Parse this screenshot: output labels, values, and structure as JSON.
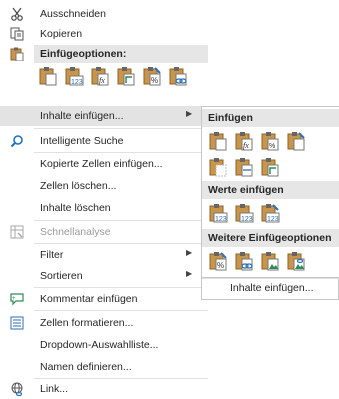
{
  "context_menu": {
    "items": [
      {
        "label": "Ausschneiden",
        "icon": "scissors-icon"
      },
      {
        "label": "Kopieren",
        "icon": "copy-icon"
      },
      {
        "label": "Einfügeoptionen:",
        "icon": "paste-icon"
      },
      {
        "label": "Inhalte einfügen...",
        "icon": "none"
      },
      {
        "label": "Intelligente Suche",
        "icon": "smart-lookup-icon"
      },
      {
        "label": "Kopierte Zellen einfügen...",
        "icon": "none"
      },
      {
        "label": "Zellen löschen...",
        "icon": "none"
      },
      {
        "label": "Inhalte löschen",
        "icon": "none"
      },
      {
        "label": "Schnellanalyse",
        "icon": "quick-analysis-icon"
      },
      {
        "label": "Filter",
        "icon": "none"
      },
      {
        "label": "Sortieren",
        "icon": "none"
      },
      {
        "label": "Kommentar einfügen",
        "icon": "comment-icon"
      },
      {
        "label": "Zellen formatieren...",
        "icon": "format-cells-icon"
      },
      {
        "label": "Dropdown-Auswahlliste...",
        "icon": "none"
      },
      {
        "label": "Namen definieren...",
        "icon": "none"
      },
      {
        "label": "Link...",
        "icon": "link-icon"
      }
    ],
    "paste_options": [
      "paste",
      "values-123",
      "formulas-fx",
      "transpose",
      "formatting-percent",
      "paste-link"
    ]
  },
  "submenu": {
    "header_paste": "Einfügen",
    "header_values": "Werte einfügen",
    "header_more": "Weitere Einfügeoptionen",
    "footer_item": "Inhalte einfügen..."
  },
  "colors": {
    "clipboard": "#a67a3a",
    "accent_green": "#2e8b57",
    "accent_blue": "#2f6fb4",
    "hover": "#e3e3e3",
    "disabled": "#9b9b9b"
  }
}
